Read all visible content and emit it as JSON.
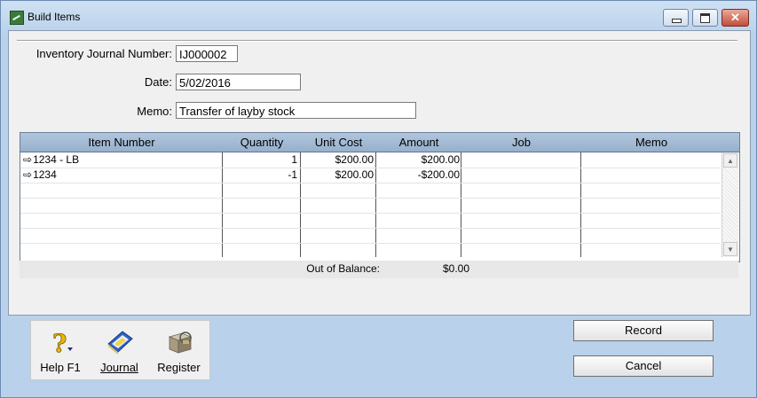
{
  "window": {
    "title": "Build Items",
    "close_glyph": "✕"
  },
  "form": {
    "journal_label": "Inventory Journal Number:",
    "journal_value": "IJ000002",
    "date_label": "Date:",
    "date_value": "5/02/2016",
    "memo_label": "Memo:",
    "memo_value": "Transfer of layby stock"
  },
  "grid": {
    "columns": [
      "Item Number",
      "Quantity",
      "Unit Cost",
      "Amount",
      "Job",
      "Memo"
    ],
    "rows": [
      {
        "item": "1234 - LB",
        "quantity": "1",
        "unit_cost": "$200.00",
        "amount": "$200.00",
        "job": "",
        "memo": ""
      },
      {
        "item": "1234",
        "quantity": "-1",
        "unit_cost": "$200.00",
        "amount": "-$200.00",
        "job": "",
        "memo": ""
      }
    ]
  },
  "balance": {
    "label": "Out of Balance:",
    "value": "$0.00"
  },
  "toolbar": {
    "help": "Help F1",
    "journal": "Journal",
    "register": "Register",
    "help_icon": "question-mark-icon",
    "journal_icon": "journal-book-icon",
    "register_icon": "register-boxes-icon"
  },
  "buttons": {
    "record": "Record",
    "cancel": "Cancel"
  },
  "colors": {
    "accent": "#97b0cb",
    "window": "#b9d1ea"
  }
}
